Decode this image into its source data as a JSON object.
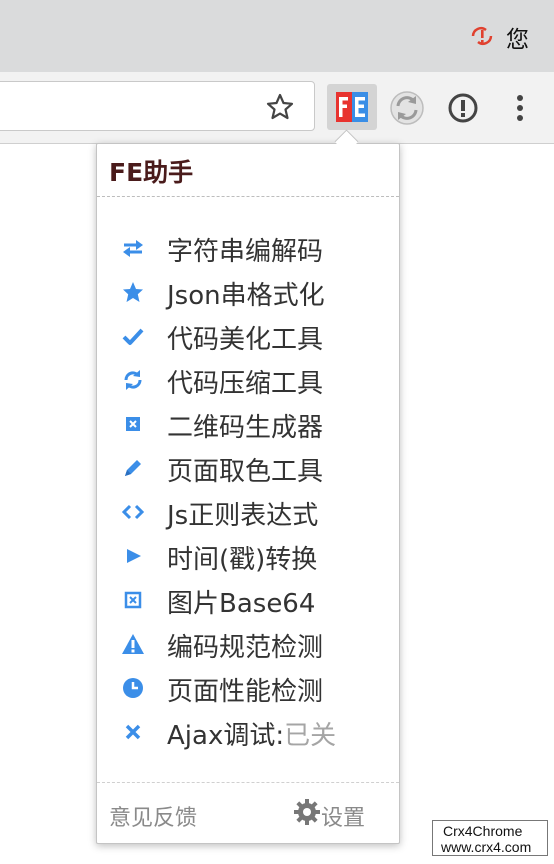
{
  "browser": {
    "profile_label": "您",
    "extensions": [
      "fe-helper-icon",
      "sync-extension-icon",
      "info-extension-icon"
    ]
  },
  "popup": {
    "title": "FE助手",
    "items": [
      {
        "label": "字符串编解码",
        "icon": "swap-arrows-icon"
      },
      {
        "label": "Json串格式化",
        "icon": "star-icon"
      },
      {
        "label": "代码美化工具",
        "icon": "checkmark-icon"
      },
      {
        "label": "代码压缩工具",
        "icon": "refresh-icon"
      },
      {
        "label": "二维码生成器",
        "icon": "qrcode-icon"
      },
      {
        "label": "页面取色工具",
        "icon": "pencil-icon"
      },
      {
        "label": "Js正则表达式",
        "icon": "code-brackets-icon"
      },
      {
        "label": "时间(戳)转换",
        "icon": "play-icon"
      },
      {
        "label": "图片Base64",
        "icon": "image-icon"
      },
      {
        "label": "编码规范检测",
        "icon": "warning-icon"
      },
      {
        "label": "页面性能检测",
        "icon": "clock-icon"
      },
      {
        "label": "Ajax调试:",
        "status": "已关",
        "icon": "close-icon"
      }
    ],
    "footer": {
      "feedback": "意见反馈",
      "settings": "设置"
    }
  },
  "watermark": {
    "line1": "Crx4Chrome",
    "line2": "www.crx4.com"
  },
  "colors": {
    "accent_blue": "#3b8ee8",
    "title": "#4a1b1b",
    "muted": "#8a8a8a",
    "disabled": "#a5a5a5"
  }
}
